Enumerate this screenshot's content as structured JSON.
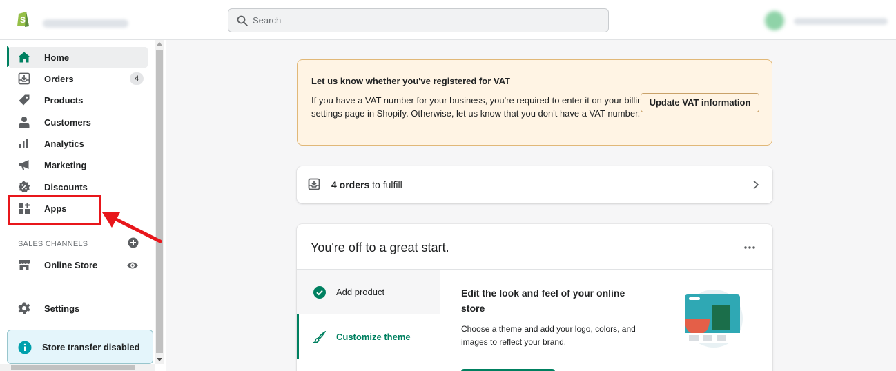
{
  "topbar": {
    "search_placeholder": "Search"
  },
  "sidebar": {
    "items": [
      {
        "label": "Home",
        "icon": "home-icon"
      },
      {
        "label": "Orders",
        "icon": "orders-icon",
        "badge": "4"
      },
      {
        "label": "Products",
        "icon": "tag-icon"
      },
      {
        "label": "Customers",
        "icon": "person-icon"
      },
      {
        "label": "Analytics",
        "icon": "bar-chart-icon"
      },
      {
        "label": "Marketing",
        "icon": "megaphone-icon"
      },
      {
        "label": "Discounts",
        "icon": "discount-icon"
      },
      {
        "label": "Apps",
        "icon": "apps-icon"
      }
    ],
    "sales_channels_heading": "SALES CHANNELS",
    "online_store_label": "Online Store",
    "settings_label": "Settings",
    "transfer_notice": "Store transfer disabled"
  },
  "vat_banner": {
    "title": "Let us know whether you've registered for VAT",
    "text": "If you have a VAT number for your business, you're required to enter it on your billing settings page in Shopify. Otherwise, let us know that you don't have a VAT number.",
    "button_label": "Update VAT information"
  },
  "orders_card": {
    "count_text": "4 orders",
    "suffix_text": " to fulfill"
  },
  "start_card": {
    "title": "You're off to a great start.",
    "steps": [
      {
        "label": "Add product",
        "status": "complete"
      },
      {
        "label": "Customize theme",
        "status": "active"
      }
    ],
    "detail_title": "Edit the look and feel of your online store",
    "detail_text": "Choose a theme and add your logo, colors, and images to reflect your brand."
  },
  "colors": {
    "accent": "#008060",
    "highlight": "#e8161b",
    "banner_bg": "#fff4e4",
    "info_bg": "#e4f5fb"
  }
}
